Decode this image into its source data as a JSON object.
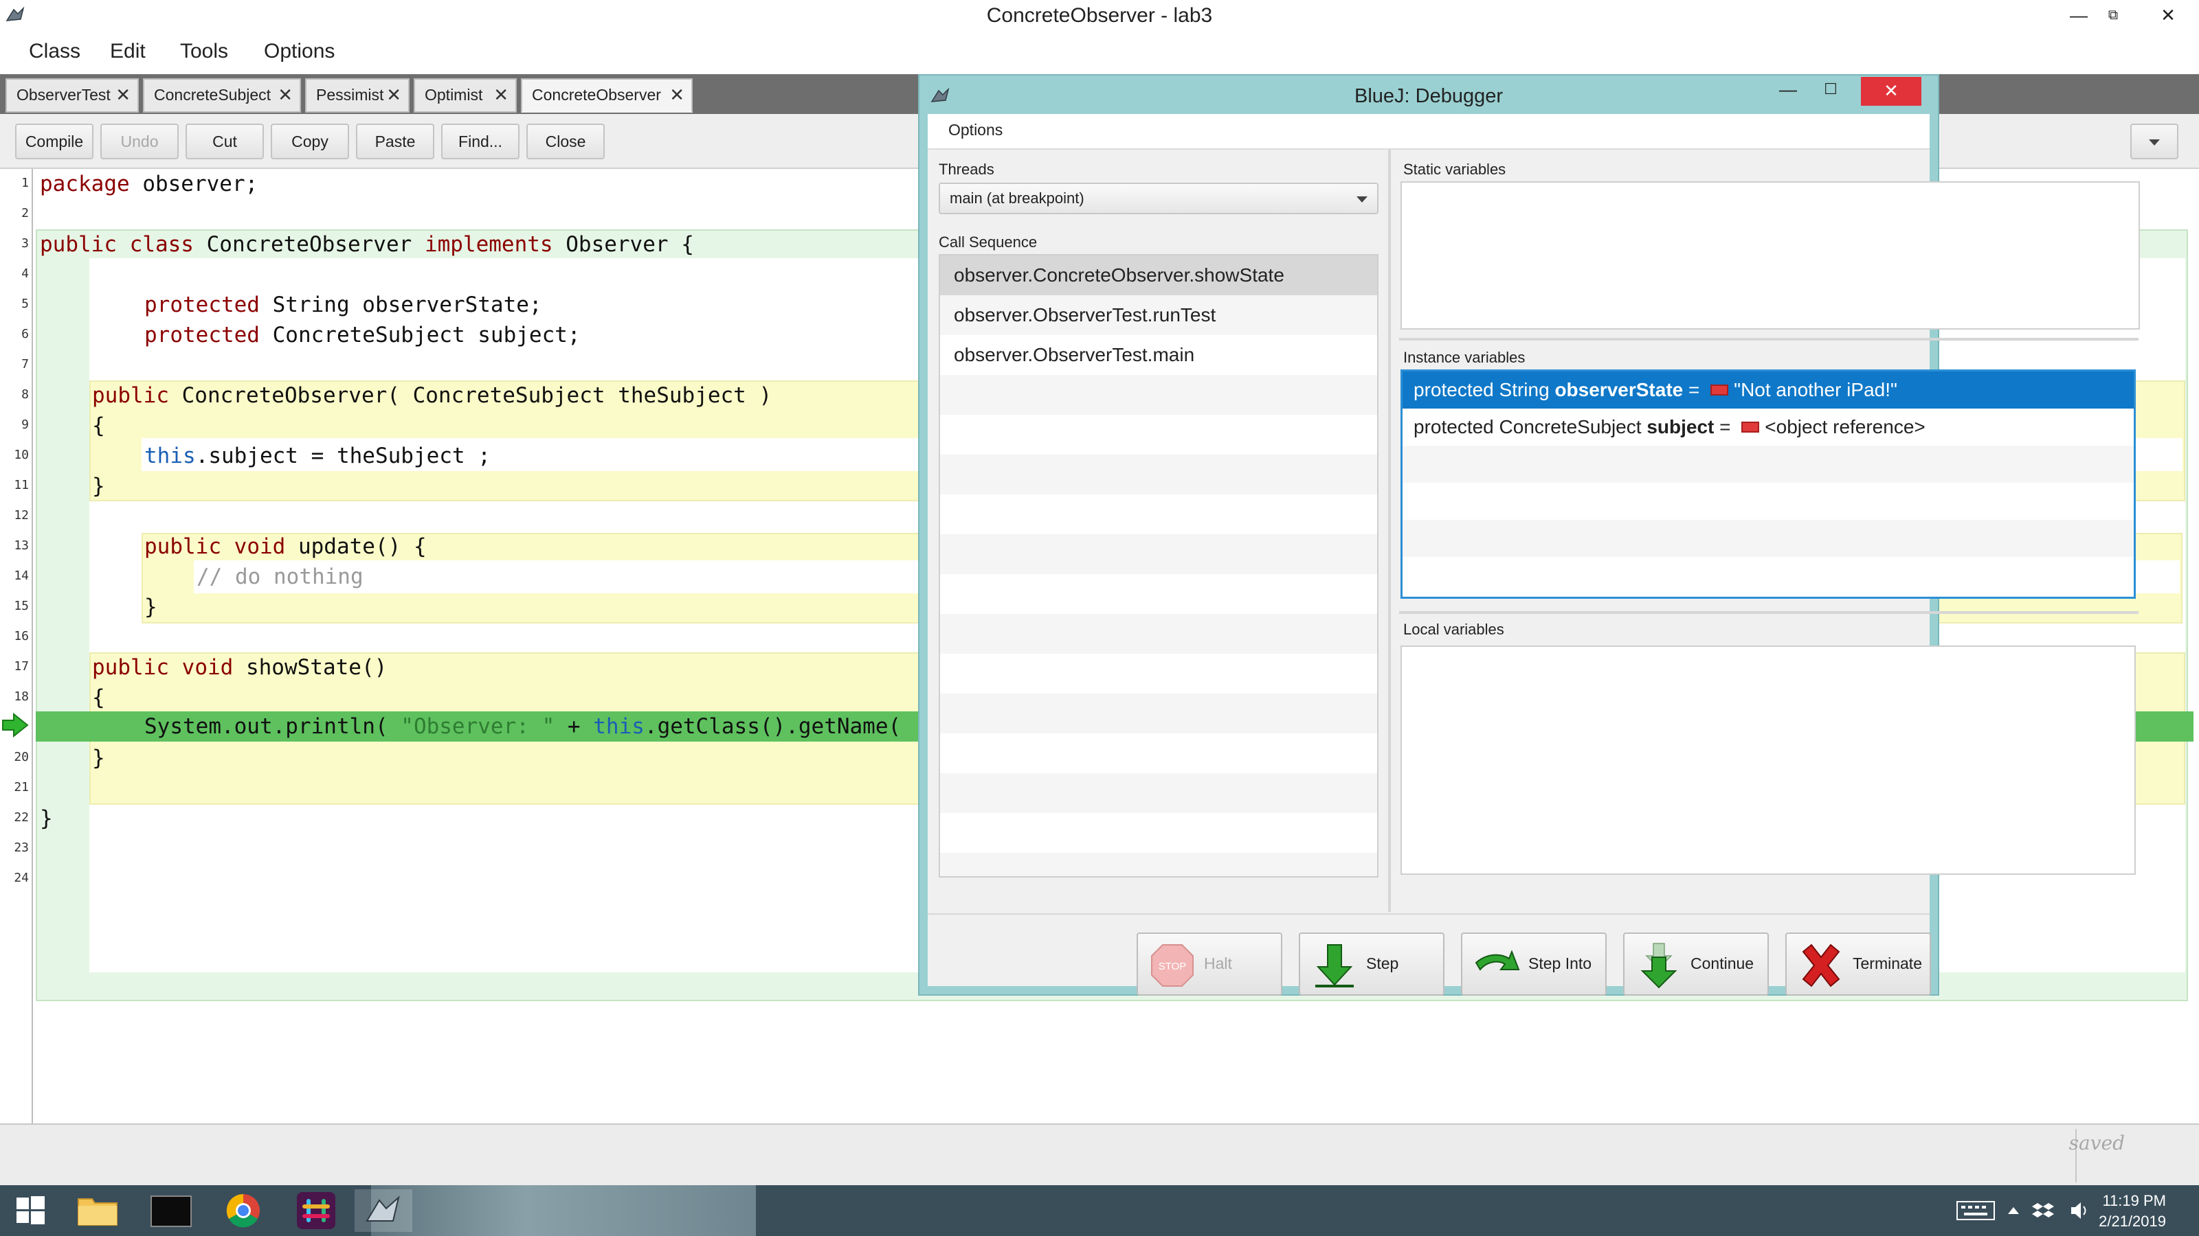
{
  "window": {
    "title": "ConcreteObserver - lab3",
    "minimize": "—",
    "maximize": "⧉",
    "close": "✕"
  },
  "menubar": [
    "Class",
    "Edit",
    "Tools",
    "Options"
  ],
  "tabs": [
    {
      "label": "ObserverTest",
      "close": "✕"
    },
    {
      "label": "ConcreteSubject",
      "close": "✕"
    },
    {
      "label": "Pessimist",
      "close": "✕"
    },
    {
      "label": "Optimist",
      "close": "✕"
    },
    {
      "label": "ConcreteObserver",
      "close": "✕",
      "active": true
    }
  ],
  "toolbar": {
    "compile": "Compile",
    "undo": "Undo",
    "cut": "Cut",
    "copy": "Copy",
    "paste": "Paste",
    "find": "Find...",
    "close": "Close"
  },
  "editor": {
    "line_numbers": [
      "1",
      "2",
      "3",
      "4",
      "5",
      "6",
      "7",
      "8",
      "9",
      "10",
      "11",
      "12",
      "13",
      "14",
      "15",
      "16",
      "17",
      "18",
      "19",
      "20",
      "21",
      "22",
      "23",
      "24"
    ],
    "execution_line": "19",
    "code": {
      "l1_kw": "package",
      "l1_rest": " observer;",
      "l3_kw1": "public",
      "l3_kw2": "class",
      "l3_name": " ConcreteObserver ",
      "l3_kw3": "implements",
      "l3_rest": " Observer {",
      "l5_kw": "protected",
      "l5_rest": " String observerState;",
      "l6_kw": "protected",
      "l6_rest": " ConcreteSubject subject;",
      "l8_kw": "public",
      "l8_rest": " ConcreteObserver( ConcreteSubject theSubject )",
      "l9": "{",
      "l10_kw": "this",
      "l10_rest": ".subject = theSubject ;",
      "l11": "}",
      "l13_kw1": "public",
      "l13_kw2": "void",
      "l13_rest": " update() {",
      "l14": "// do nothing",
      "l15": "}",
      "l17_kw1": "public",
      "l17_kw2": "void",
      "l17_rest": " showState()",
      "l18": "{",
      "l19_a": "System.out.println( ",
      "l19_str": "\"Observer: \"",
      "l19_b": " + ",
      "l19_kw": "this",
      "l19_c": ".getClass().getName(",
      "l20": "}",
      "l22": "}"
    }
  },
  "status": {
    "saved": "saved"
  },
  "debugger": {
    "title": "BlueJ:  Debugger",
    "minimize": "—",
    "maximize": "☐",
    "close": "✕",
    "menu_options": "Options",
    "threads_label": "Threads",
    "threads_selected": "main (at breakpoint)",
    "call_sequence_label": "Call Sequence",
    "call_sequence": [
      "observer.ConcreteObserver.showState",
      "observer.ObserverTest.runTest",
      "observer.ObserverTest.main"
    ],
    "static_label": "Static variables",
    "instance_label": "Instance variables",
    "instance_vars": [
      {
        "modifiers": "protected  String ",
        "name": "observerState",
        "eq": " = ",
        "value": "\"Not another iPad!\""
      },
      {
        "modifiers": "protected  ConcreteSubject ",
        "name": "subject",
        "eq": " = ",
        "value": "<object reference>"
      }
    ],
    "local_label": "Local variables",
    "buttons": {
      "halt": "Halt",
      "halt_icon_text": "STOP",
      "step": "Step",
      "step_into": "Step Into",
      "continue": "Continue",
      "terminate": "Terminate"
    }
  },
  "taskbar": {
    "time": "11:19 PM",
    "date": "2/21/2019"
  },
  "colors": {
    "scope_green": "#e6f6e6",
    "scope_yellow": "#fbfbc9",
    "exec_line": "#5ec15e",
    "debugger_frame": "#9ad0d2",
    "selection_blue": "#0f78c8"
  }
}
